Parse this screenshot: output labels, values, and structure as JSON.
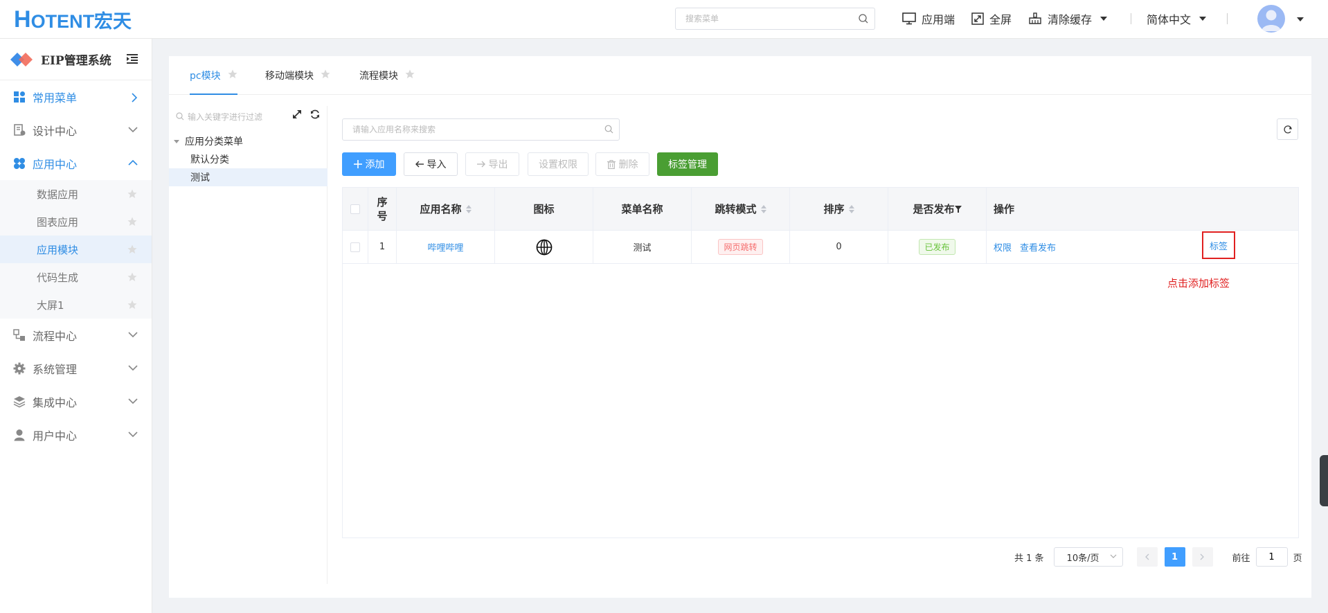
{
  "header": {
    "logo_main": "H",
    "logo_rest": "OTENT宏天",
    "search_placeholder": "搜索菜单",
    "actions": [
      {
        "label": "应用端",
        "icon": "monitor-icon"
      },
      {
        "label": "全屏",
        "icon": "fullscreen-icon"
      },
      {
        "label": "清除缓存",
        "icon": "clear-cache-icon"
      }
    ],
    "language": "简体中文"
  },
  "sidebar": {
    "title": "EIP管理系统",
    "menu": [
      {
        "label": "常用菜单",
        "active": true
      },
      {
        "label": "设计中心"
      },
      {
        "label": "应用中心",
        "active": true
      },
      {
        "label": "流程中心"
      },
      {
        "label": "系统管理"
      },
      {
        "label": "集成中心"
      },
      {
        "label": "用户中心"
      }
    ],
    "sub_items": [
      "数据应用",
      "图表应用",
      "应用模块",
      "代码生成",
      "大屏1"
    ]
  },
  "tabs": [
    "pc模块",
    "移动端模块",
    "流程模块"
  ],
  "tree": {
    "search_placeholder": "输入关键字进行过滤",
    "root": "应用分类菜单",
    "children": [
      "默认分类",
      "测试"
    ]
  },
  "panel": {
    "search_placeholder": "请输入应用名称来搜索",
    "buttons": {
      "add": "添加",
      "import": "导入",
      "export": "导出",
      "permission": "设置权限",
      "delete": "删除",
      "tag_manage": "标签管理"
    }
  },
  "table": {
    "headers": {
      "seq_top": "序",
      "seq_bottom": "号",
      "app_name": "应用名称",
      "icon": "图标",
      "menu_name": "菜单名称",
      "jump_mode": "跳转模式",
      "sort": "排序",
      "published": "是否发布",
      "ops": "操作"
    },
    "row": {
      "seq": "1",
      "app_name": "哔哩哔哩",
      "menu_name": "测试",
      "jump_mode": "网页跳转",
      "sort": "0",
      "published": "已发布",
      "op_permission": "权限",
      "op_view": "查看发布",
      "op_tag": "标签"
    }
  },
  "annotation": "点击添加标签",
  "pager": {
    "total": "共 1 条",
    "page_size": "10条/页",
    "current": "1",
    "goto_prefix": "前往",
    "goto_value": "1",
    "goto_suffix": "页"
  },
  "colors": {
    "primary": "#409eff",
    "brand": "#2f8de4",
    "success": "#4a9e33",
    "danger": "#e02020"
  }
}
